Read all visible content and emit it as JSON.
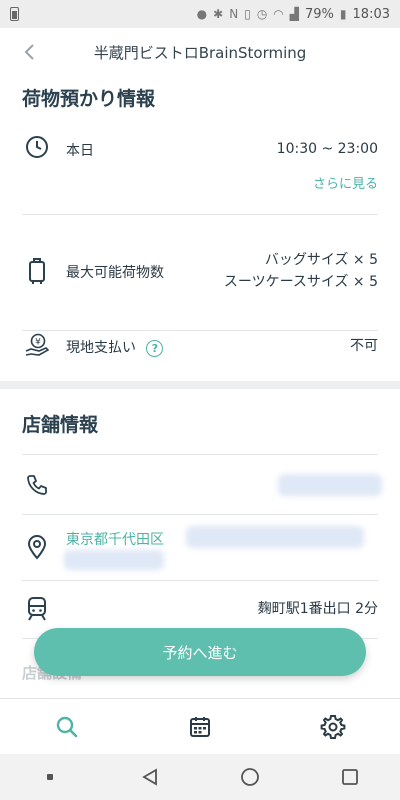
{
  "status_bar": {
    "battery_percent": "79%",
    "time": "18:03"
  },
  "header": {
    "title": "半蔵門ビストロBrainStorming",
    "back_icon": "chevron-left-icon"
  },
  "luggage_section": {
    "title": "荷物預かり情報",
    "hours": {
      "icon": "clock-icon",
      "label": "本日",
      "value": "10:30 ~ 23:00",
      "more_link": "さらに見る"
    },
    "capacity": {
      "icon": "suitcase-icon",
      "label": "最大可能荷物数",
      "bag_size": "バッグサイズ × 5",
      "suitcase_size": "スーツケースサイズ × 5"
    },
    "onsite_payment": {
      "icon": "yen-hand-icon",
      "label": "現地支払い",
      "help": "?",
      "value": "不可"
    }
  },
  "store_section": {
    "title": "店舗情報",
    "phone_icon": "phone-icon",
    "address": {
      "icon": "map-pin-icon",
      "value": "東京都千代田区"
    },
    "station": {
      "icon": "train-icon",
      "value": "麹町駅1番出口 2分"
    },
    "next_title_partial": "店舗設備"
  },
  "cta": {
    "label": "予約へ進む"
  },
  "tabs": [
    {
      "icon": "search-icon",
      "active": true
    },
    {
      "icon": "calendar-icon",
      "active": false
    },
    {
      "icon": "gear-icon",
      "active": false
    }
  ],
  "colors": {
    "accent": "#4bb4a6",
    "cta": "#5fbfae",
    "heading": "#2b4150",
    "text": "#2b3a45"
  }
}
